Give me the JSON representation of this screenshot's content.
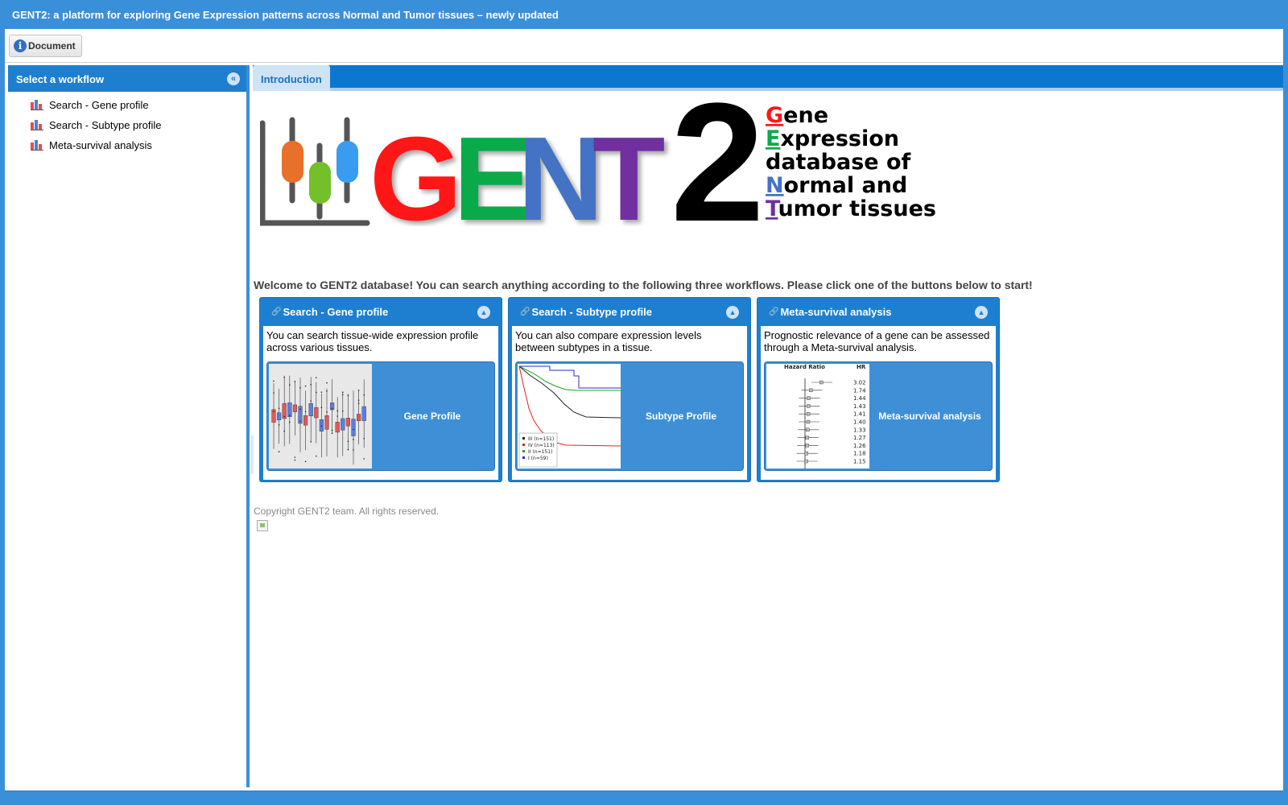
{
  "window": {
    "title": "GENT2: a platform for exploring Gene Expression patterns across Normal and Tumor tissues – newly updated"
  },
  "toolbar": {
    "document_label": "Document"
  },
  "sidebar": {
    "title": "Select a workflow",
    "items": [
      {
        "label": "Search - Gene profile",
        "icon": "bar-chart-icon"
      },
      {
        "label": "Search - Subtype profile",
        "icon": "bar-chart-icon"
      },
      {
        "label": "Meta-survival analysis",
        "icon": "bar-chart-icon"
      }
    ]
  },
  "tabs": [
    {
      "label": "Introduction"
    }
  ],
  "logo": {
    "word": "GENT2",
    "letters": [
      "G",
      "E",
      "N",
      "T",
      "2"
    ],
    "letter_colors": [
      "#ff1616",
      "#0aaa4a",
      "#4472c4",
      "#7030a0",
      "#000000"
    ],
    "tagline": [
      {
        "initial": "G",
        "rest": "ene",
        "color": "#ff1616"
      },
      {
        "initial": "E",
        "rest": "xpression",
        "color": "#0aaa4a"
      },
      {
        "initial": "",
        "rest": "database of",
        "color": "#000000"
      },
      {
        "initial": "N",
        "rest": "ormal and",
        "color": "#4472c4"
      },
      {
        "initial": "T",
        "rest": "umor tissues",
        "color": "#7030a0"
      }
    ]
  },
  "welcome": "Welcome to GENT2 database! You can search anything according to the following three workflows. Please click one of the buttons below to start!",
  "cards": [
    {
      "title": "Search - Gene profile",
      "description": "You can search tissue-wide expression profile across various tissues.",
      "button": "Gene Profile"
    },
    {
      "title": "Search - Subtype profile",
      "description": "You can also compare expression levels between subtypes in a tissue.",
      "button": "Subtype Profile",
      "legend": [
        "III (n=151)",
        "IV (n=113)",
        "II (n=151)",
        "I (n=59)"
      ]
    },
    {
      "title": "Meta-survival analysis",
      "description": "Prognostic relevance of a gene can be assessed through a Meta-survival analysis.",
      "button": "Meta-survival analysis",
      "forest": {
        "col1": "Hazard Ratio",
        "col2": "HR",
        "values": [
          "3.02",
          "1.74",
          "1.44",
          "1.43",
          "1.41",
          "1.40",
          "1.33",
          "1.27",
          "1.26",
          "1.18",
          "1.15"
        ]
      }
    }
  ],
  "copyright": "Copyright GENT2 team. All rights reserved.",
  "colors": {
    "accent": "#1e7fd0",
    "frame": "#3a8fd9"
  }
}
